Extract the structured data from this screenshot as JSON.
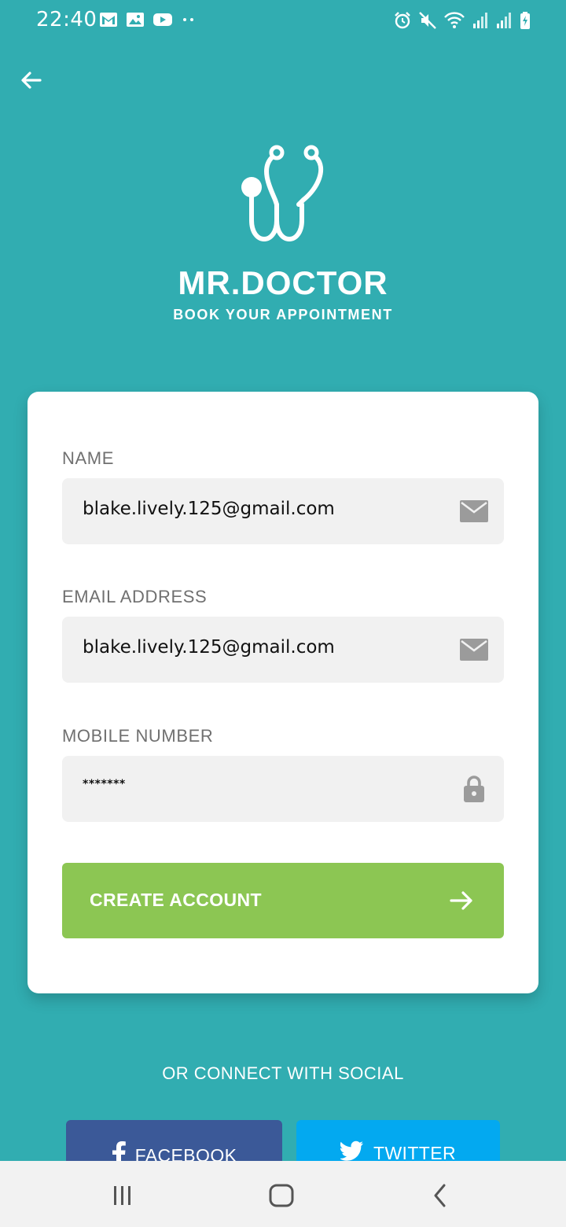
{
  "status_bar": {
    "time": "22:40"
  },
  "header": {
    "back_icon": "arrow-left-icon"
  },
  "brand": {
    "logo_icon": "stethoscope-icon",
    "title": "MR.DOCTOR",
    "tagline": "BOOK YOUR APPOINTMENT"
  },
  "form": {
    "fields": [
      {
        "label": "NAME",
        "value": "blake.lively.125@gmail.com",
        "icon": "mail-icon"
      },
      {
        "label": "EMAIL ADDRESS",
        "value": "blake.lively.125@gmail.com",
        "icon": "mail-icon"
      },
      {
        "label": "MOBILE NUMBER",
        "value": "*******",
        "icon": "lock-icon"
      }
    ],
    "submit_label": "CREATE ACCOUNT"
  },
  "social": {
    "heading": "OR CONNECT WITH SOCIAL",
    "facebook_label": "FACEBOOK",
    "twitter_label": "TWITTER"
  },
  "colors": {
    "background": "#31adb1",
    "button_green": "#8cc653",
    "facebook_blue": "#3b5998",
    "twitter_blue": "#03a9f0"
  }
}
